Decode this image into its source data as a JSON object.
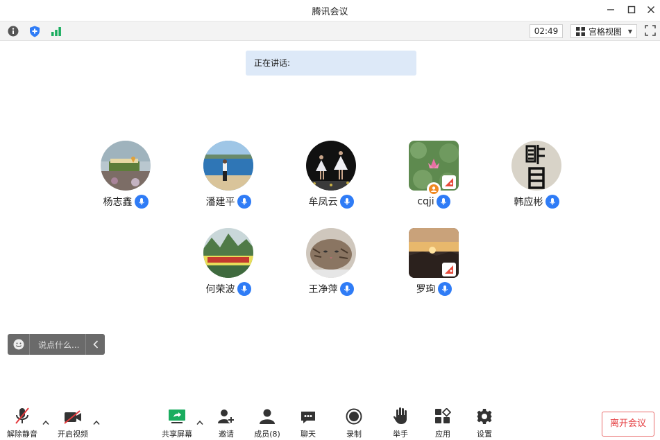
{
  "window": {
    "title": "腾讯会议"
  },
  "infobar": {
    "timer": "02:49",
    "view_label": "宫格视图"
  },
  "speaking": {
    "label": "正在讲话:"
  },
  "participants": [
    {
      "name": "杨志鑫"
    },
    {
      "name": "潘建平"
    },
    {
      "name": "牟凤云"
    },
    {
      "name": "cqji"
    },
    {
      "name": "韩应彬"
    },
    {
      "name": "何荣波"
    },
    {
      "name": "王净萍"
    },
    {
      "name": "罗珣"
    }
  ],
  "chat": {
    "placeholder": "说点什么..."
  },
  "toolbar": {
    "unmute": "解除静音",
    "start_video": "开启视频",
    "share_screen": "共享屏幕",
    "invite": "邀请",
    "members": "成员(8)",
    "chat": "聊天",
    "record": "录制",
    "raise_hand": "举手",
    "apps": "应用",
    "settings": "设置",
    "leave": "离开会议"
  },
  "colors": {
    "accent": "#2f7cf6",
    "leave": "#e4393c",
    "speaking_bg": "#dde9f8",
    "share_green": "#1aad5f"
  }
}
